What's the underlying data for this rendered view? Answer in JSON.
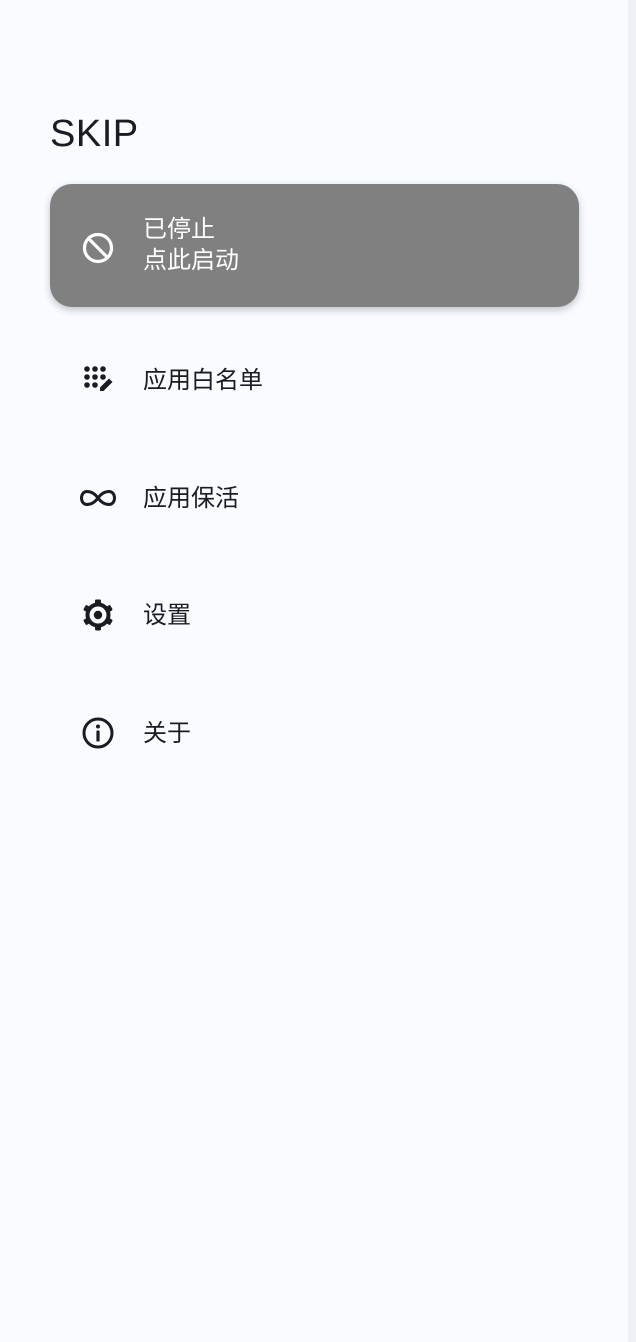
{
  "app": {
    "title": "SKIP"
  },
  "status_card": {
    "line1": "已停止",
    "line2": "点此启动",
    "icon": "block-icon",
    "background": "#808080",
    "text_color": "#ffffff"
  },
  "menu": {
    "items": [
      {
        "label": "应用白名单",
        "icon": "app-whitelist-icon"
      },
      {
        "label": "应用保活",
        "icon": "infinity-icon"
      },
      {
        "label": "设置",
        "icon": "gear-icon"
      },
      {
        "label": "关于",
        "icon": "info-icon"
      }
    ]
  },
  "colors": {
    "background": "#f8fbff",
    "text": "#1c1c1e"
  }
}
